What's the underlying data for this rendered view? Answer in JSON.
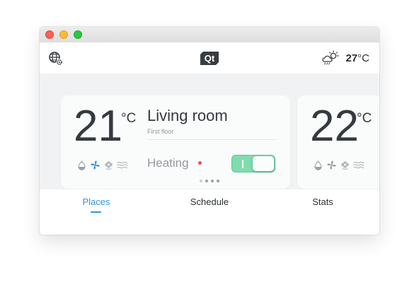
{
  "app": {
    "logo_text": "Qt"
  },
  "header": {
    "weather_icon": "cloudy-sun-rain-icon",
    "outdoor_temp_value": "27",
    "outdoor_temp_unit": "°C"
  },
  "rooms": [
    {
      "temperature": "21",
      "unit": "°C",
      "name": "Living room",
      "floor": "First floor",
      "mode_label": "Heating",
      "mode_on": true,
      "icons": [
        "drop-icon",
        "fan-icon",
        "flower-icon",
        "waves-icon"
      ]
    },
    {
      "temperature": "22",
      "unit": "°C",
      "icons": [
        "drop-icon",
        "fan-icon",
        "flower-icon",
        "waves-icon"
      ]
    }
  ],
  "pager": {
    "count": 4,
    "active_index": 1
  },
  "nav": {
    "tabs": [
      {
        "label": "Places",
        "active": true
      },
      {
        "label": "Schedule",
        "active": false
      },
      {
        "label": "Stats",
        "active": false
      }
    ]
  },
  "colors": {
    "accent": "#3494d8",
    "toggle_on": "#7fdcae",
    "heating_dot": "#ec4b58",
    "fan_active": "#3494d8"
  }
}
